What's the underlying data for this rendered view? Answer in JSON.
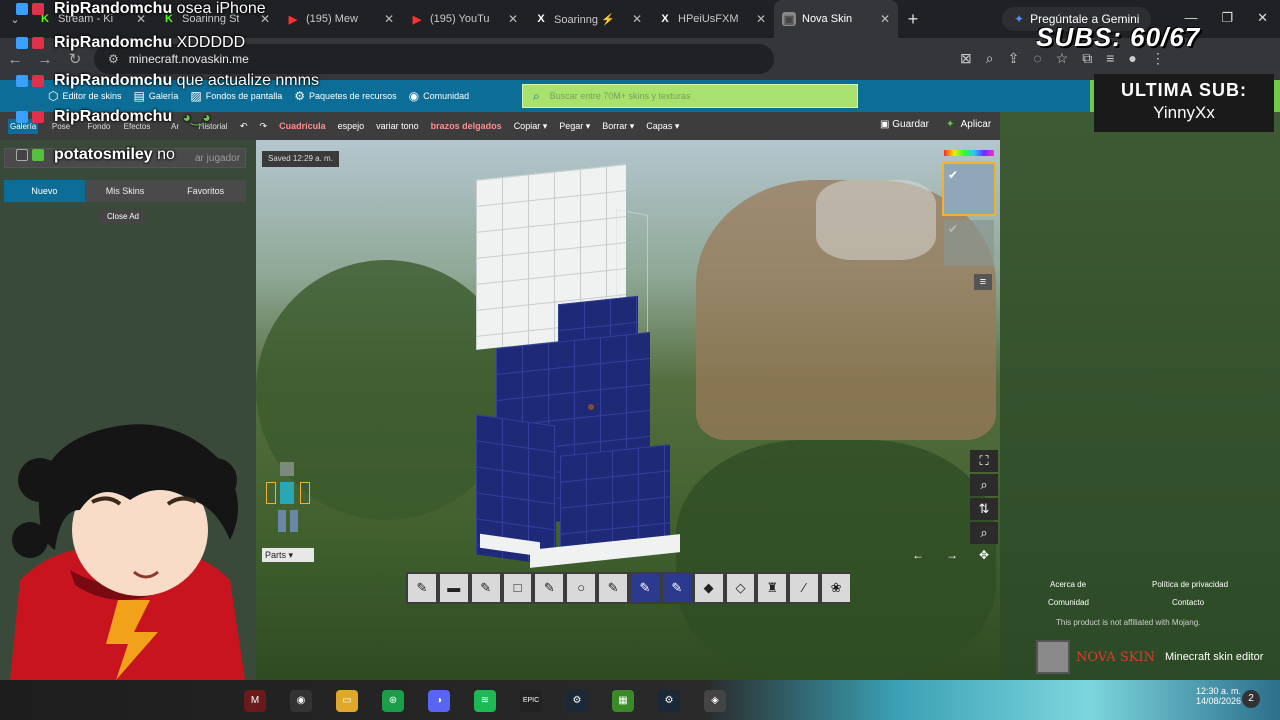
{
  "browser": {
    "tabs": [
      {
        "label": "Stream - Ki",
        "icon": "K",
        "icon_color": "#53fc18"
      },
      {
        "label": "Soarinng St",
        "icon": "K",
        "icon_color": "#53fc18"
      },
      {
        "label": "(195) Mew",
        "icon": "▶",
        "icon_color": "#ff0000"
      },
      {
        "label": "(195) YouTu",
        "icon": "▶",
        "icon_color": "#ff0000"
      },
      {
        "label": "Soarinng ⚡",
        "icon": "X",
        "icon_color": "#000000"
      },
      {
        "label": "HPeiUsFXM",
        "icon": "X",
        "icon_color": "#000000"
      },
      {
        "label": "Nova Skin",
        "icon": "▣",
        "icon_color": "#888888"
      }
    ],
    "gemini_label": "Pregúntale a Gemini",
    "url": "minecraft.novaskin.me"
  },
  "nova": {
    "nav": [
      {
        "label": "Editor de skins",
        "icon": "⬡"
      },
      {
        "label": "Galería",
        "icon": "▤"
      },
      {
        "label": "Fondos de pantalla",
        "icon": "▨"
      },
      {
        "label": "Paquetes de recursos",
        "icon": "⚙"
      },
      {
        "label": "Comunidad",
        "icon": "◉"
      }
    ],
    "search_placeholder": "Buscar entre 70M+ skins y texturas",
    "subtabs": [
      "Galería",
      "Pose",
      "Fondo",
      "Efectos",
      "Ar",
      "Historial"
    ],
    "tools": [
      "Cuadrícula",
      "espejo",
      "variar tono",
      "brazos delgados",
      "Copiar ▾",
      "Pegar ▾",
      "Borrar ▾",
      "Capas ▾"
    ],
    "save_label": "Guardar",
    "apply_label": "Aplicar",
    "player_search_placeholder": "ar jugador",
    "skin_tabs": [
      "Nuevo",
      "Mis Skins",
      "Favoritos"
    ],
    "close_ad": "Close Ad",
    "saved_status": "Saved 12:29 a. m.",
    "parts_label": "Parts",
    "footer": {
      "about": "Acerca de",
      "privacy": "Política de privacidad",
      "community": "Comunidad",
      "contact": "Contacto",
      "affiliation": "This product is not affiliated with Mojang.",
      "brand": "NOVA SKIN",
      "brand_desc": "Minecraft skin editor"
    }
  },
  "chat": [
    {
      "user": "RipRandomchu",
      "message": "osea iPhone"
    },
    {
      "user": "RipRandomchu",
      "message": "XDDDDD"
    },
    {
      "user": "RipRandomchu",
      "message": "que actualize nmms"
    },
    {
      "user": "RipRandomchu",
      "message": ""
    },
    {
      "user": "potatosmiley",
      "message": "no"
    }
  ],
  "overlay": {
    "subs": "SUBS: 60/67",
    "last_sub_title": "ULTIMA SUB:",
    "last_sub_name": "YinnyXx"
  },
  "taskbar": {
    "time": "12:30 a. m.",
    "date": "14/08/2026",
    "notifications": "2"
  }
}
